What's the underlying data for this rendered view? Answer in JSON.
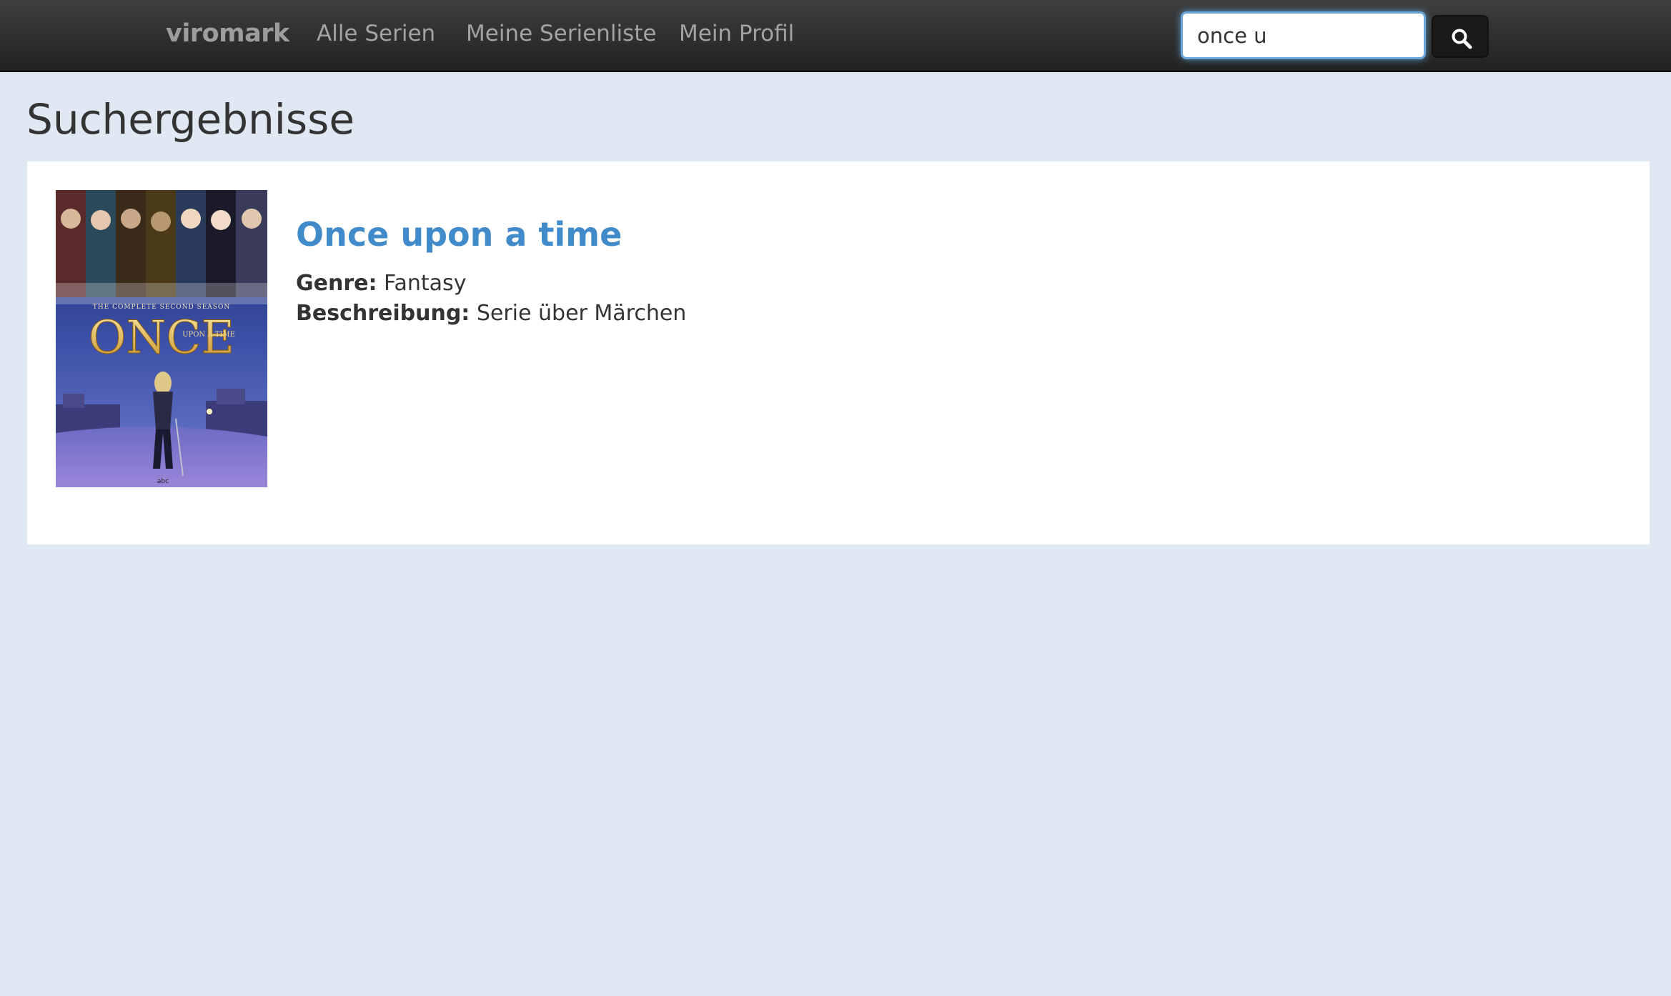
{
  "navbar": {
    "brand": "viromark",
    "links": [
      {
        "label": "Alle Serien"
      },
      {
        "label": "Meine Serienliste"
      },
      {
        "label": "Mein Profil"
      }
    ],
    "search": {
      "value": "once u",
      "icon": "search-icon"
    }
  },
  "main": {
    "title": "Suchergebnisse",
    "results": [
      {
        "title": "Once upon a time",
        "genre_label": "Genre:",
        "genre": "Fantasy",
        "description_label": "Beschreibung:",
        "description": "Serie über Märchen",
        "poster": {
          "tagline": "THE COMPLETE SECOND SEASON",
          "logo": "ONCE",
          "logo_sub": "UPON A TIME",
          "network": "abc"
        }
      }
    ]
  },
  "colors": {
    "page_background": "#e0e9f3",
    "navbar": "#2b2b2b",
    "link_accent": "#428bca",
    "nav_text": "#a3a3a3"
  }
}
